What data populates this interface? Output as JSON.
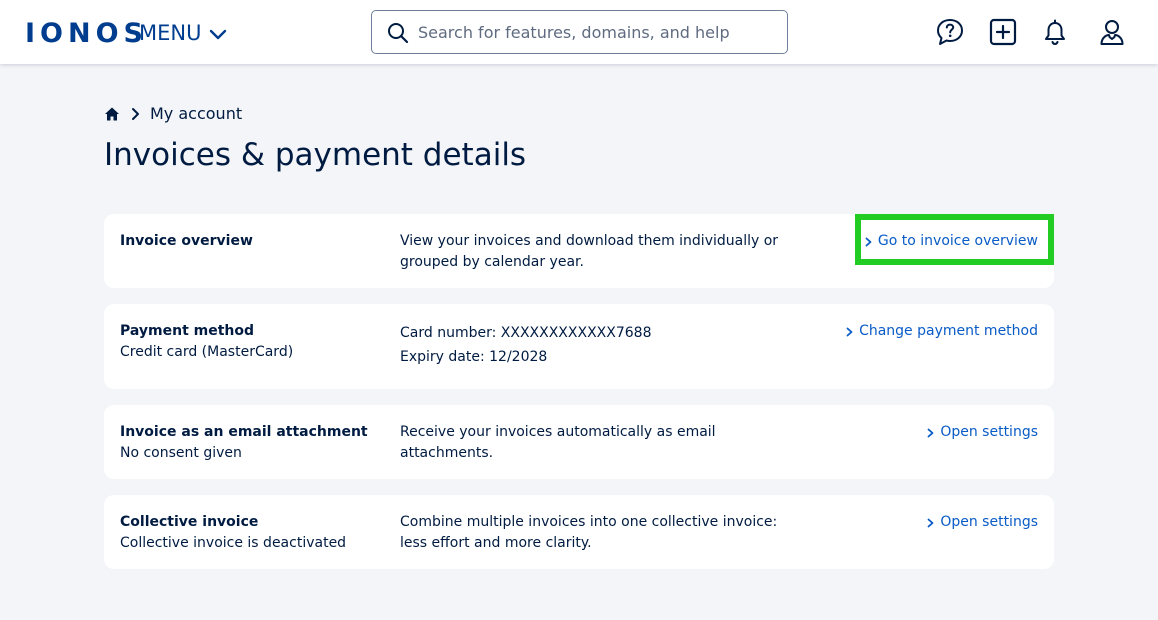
{
  "header": {
    "logo": "IONOS",
    "menu_label": "MENU",
    "search_placeholder": "Search for features, domains, and help"
  },
  "breadcrumb": {
    "current": "My account"
  },
  "page_title": "Invoices & payment details",
  "cards": [
    {
      "title": "Invoice overview",
      "subtitle": "",
      "description": "View your invoices and download them individually or grouped by calendar year.",
      "action": "Go to invoice overview"
    },
    {
      "title": "Payment method",
      "subtitle": "Credit card (MasterCard)",
      "card_number": "Card number: XXXXXXXXXXXX7688",
      "expiry": "Expiry date: 12/2028",
      "action": "Change payment method"
    },
    {
      "title": "Invoice as an email attachment",
      "subtitle": "No consent given",
      "description": "Receive your invoices automatically as email attachments.",
      "action": "Open settings"
    },
    {
      "title": "Collective invoice",
      "subtitle": "Collective invoice is deactivated",
      "description": "Combine multiple invoices into one collective invoice: less effort and more clarity.",
      "action": "Open settings"
    }
  ],
  "colors": {
    "brand": "#003d8f",
    "text": "#001b41",
    "link": "#095bc6",
    "background": "#f4f5f8",
    "highlight": "#22cc22"
  }
}
